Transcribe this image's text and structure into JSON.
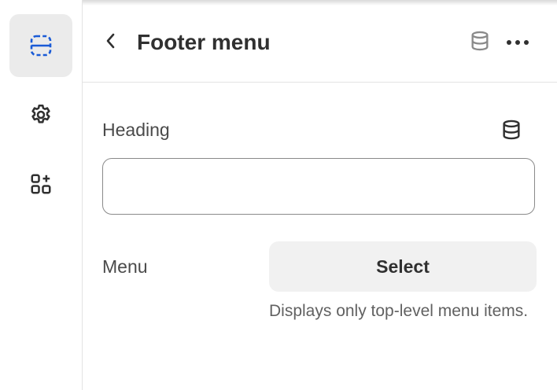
{
  "rail": {
    "items": [
      {
        "name": "sections-icon",
        "active": true
      },
      {
        "name": "gear-icon",
        "active": false
      },
      {
        "name": "add-apps-icon",
        "active": false
      }
    ]
  },
  "header": {
    "title": "Footer menu",
    "icons": [
      "chevron-left-icon",
      "database-icon",
      "more-horizontal-icon"
    ]
  },
  "fields": {
    "heading": {
      "label": "Heading",
      "value": "",
      "icon": "database-icon"
    },
    "menu": {
      "label": "Menu",
      "button_label": "Select",
      "help": "Displays only top-level menu items."
    }
  },
  "colors": {
    "accent": "#1a5bd6",
    "text": "#303030",
    "muted": "#616161",
    "active_bg": "#ebebeb"
  }
}
